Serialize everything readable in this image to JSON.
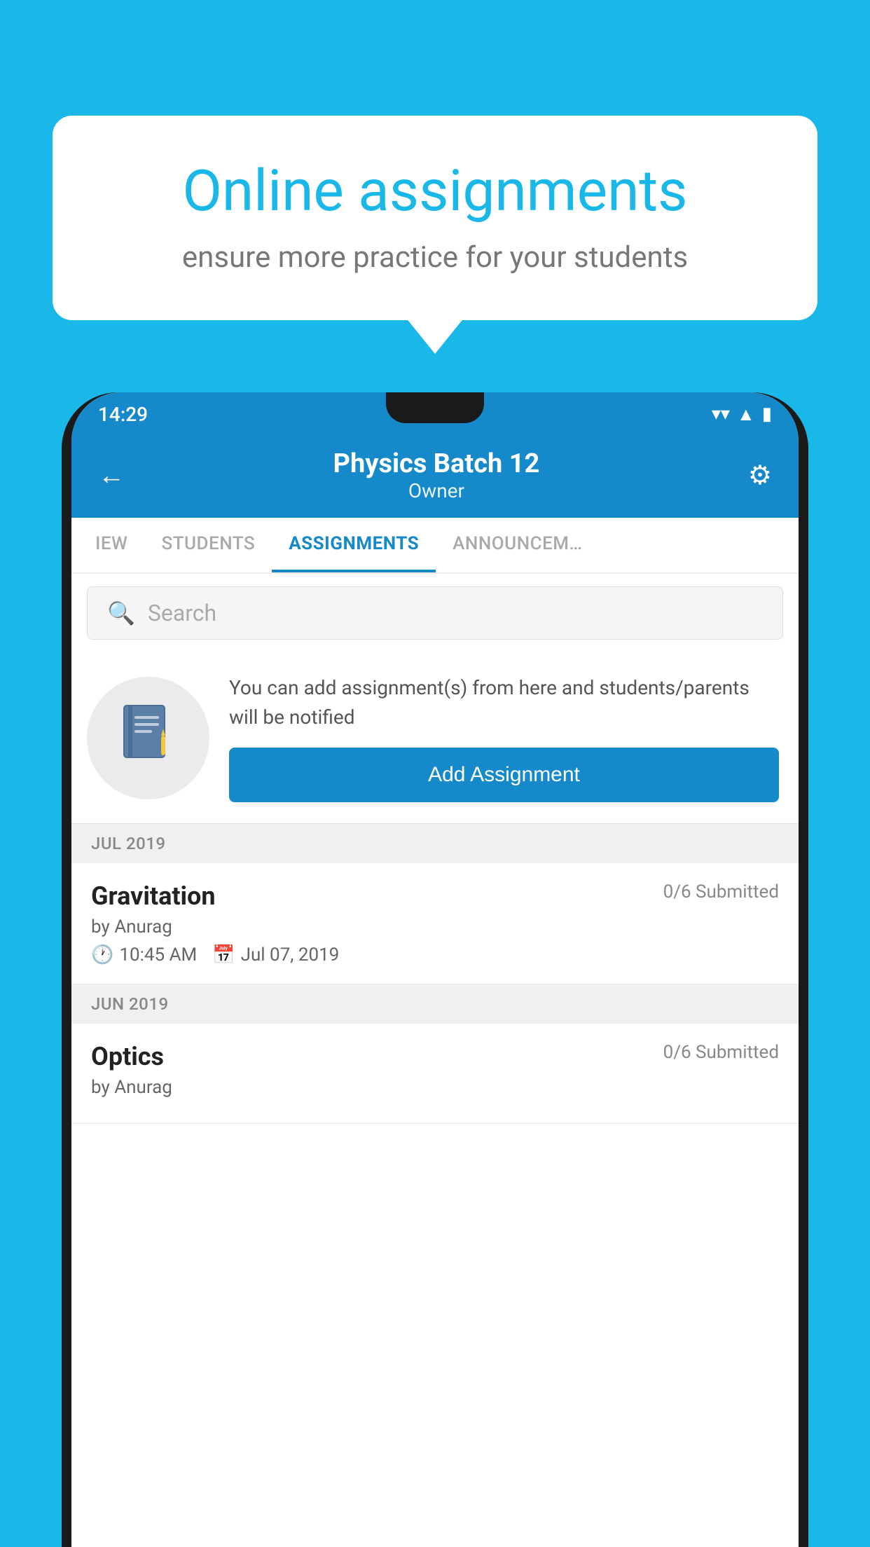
{
  "background_color": "#1ab8e8",
  "speech_bubble": {
    "title": "Online assignments",
    "subtitle": "ensure more practice for your students"
  },
  "status_bar": {
    "time": "14:29",
    "wifi": "▲",
    "signal": "▲",
    "battery": "▮"
  },
  "app_header": {
    "title": "Physics Batch 12",
    "subtitle": "Owner",
    "back_label": "←",
    "settings_label": "⚙"
  },
  "tabs": [
    {
      "label": "IEW",
      "active": false
    },
    {
      "label": "STUDENTS",
      "active": false
    },
    {
      "label": "ASSIGNMENTS",
      "active": true
    },
    {
      "label": "ANNOUNCEM…",
      "active": false
    }
  ],
  "search": {
    "placeholder": "Search"
  },
  "cta": {
    "text": "You can add assignment(s) from here and students/parents will be notified",
    "button_label": "Add Assignment"
  },
  "sections": [
    {
      "month_label": "JUL 2019",
      "assignments": [
        {
          "name": "Gravitation",
          "submitted": "0/6 Submitted",
          "author": "by Anurag",
          "time": "10:45 AM",
          "date": "Jul 07, 2019"
        }
      ]
    },
    {
      "month_label": "JUN 2019",
      "assignments": [
        {
          "name": "Optics",
          "submitted": "0/6 Submitted",
          "author": "by Anurag",
          "time": "",
          "date": ""
        }
      ]
    }
  ],
  "icons": {
    "search": "🔍",
    "clock": "🕐",
    "calendar": "📅",
    "notebook": "📓"
  }
}
